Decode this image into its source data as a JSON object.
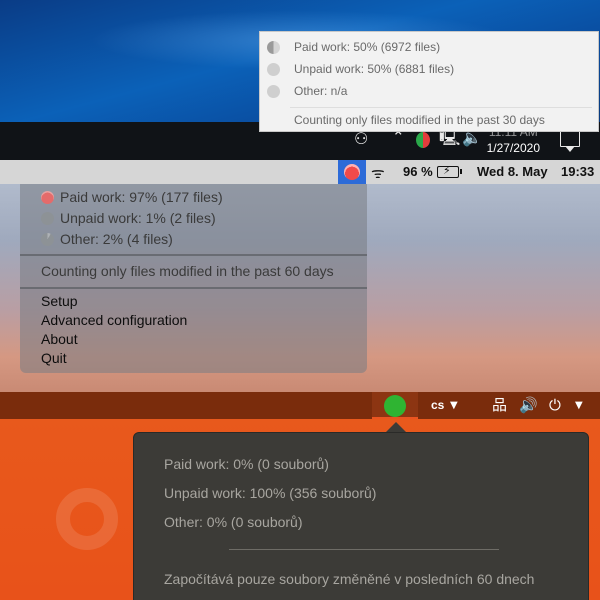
{
  "windows": {
    "menu": {
      "items": [
        {
          "label": "Paid work: 50% (6972 files)",
          "icon": "half-circle-icon"
        },
        {
          "label": "Unpaid work: 50% (6881 files)",
          "icon": "circle-icon"
        },
        {
          "label": "Other: n/a",
          "icon": "circle-icon"
        }
      ],
      "note": "Counting only files modified in the past 30 days"
    },
    "taskbar": {
      "time": "11:11 AM",
      "date": "1/27/2020"
    }
  },
  "mac": {
    "menubar": {
      "battery": "96 %",
      "datetime": "Wed 8. May",
      "time": "19:33"
    },
    "menu": {
      "stats": [
        {
          "label": "Paid work: 97% (177 files)"
        },
        {
          "label": "Unpaid work: 1% (2 files)"
        },
        {
          "label": "Other: 2% (4 files)"
        }
      ],
      "note": "Counting only files modified in the past 60 days",
      "actions": [
        {
          "label": "Setup"
        },
        {
          "label": "Advanced configuration"
        },
        {
          "label": "About"
        },
        {
          "label": "Quit"
        }
      ]
    }
  },
  "ubuntu": {
    "topbar": {
      "language": "cs"
    },
    "popup": {
      "items": [
        {
          "label": "Paid work: 0% (0 souborů)"
        },
        {
          "label": "Unpaid work: 100% (356 souborů)"
        },
        {
          "label": "Other: 0% (0 souborů)"
        }
      ],
      "note": "Započítává pouze soubory změněné v posledních 60 dnech"
    }
  },
  "colors": {
    "mac_highlight": "#2d6bd8",
    "ubuntu_orange": "#e95420",
    "ubuntu_status_green": "#2fb432",
    "paid_red": "#f04a4a"
  }
}
